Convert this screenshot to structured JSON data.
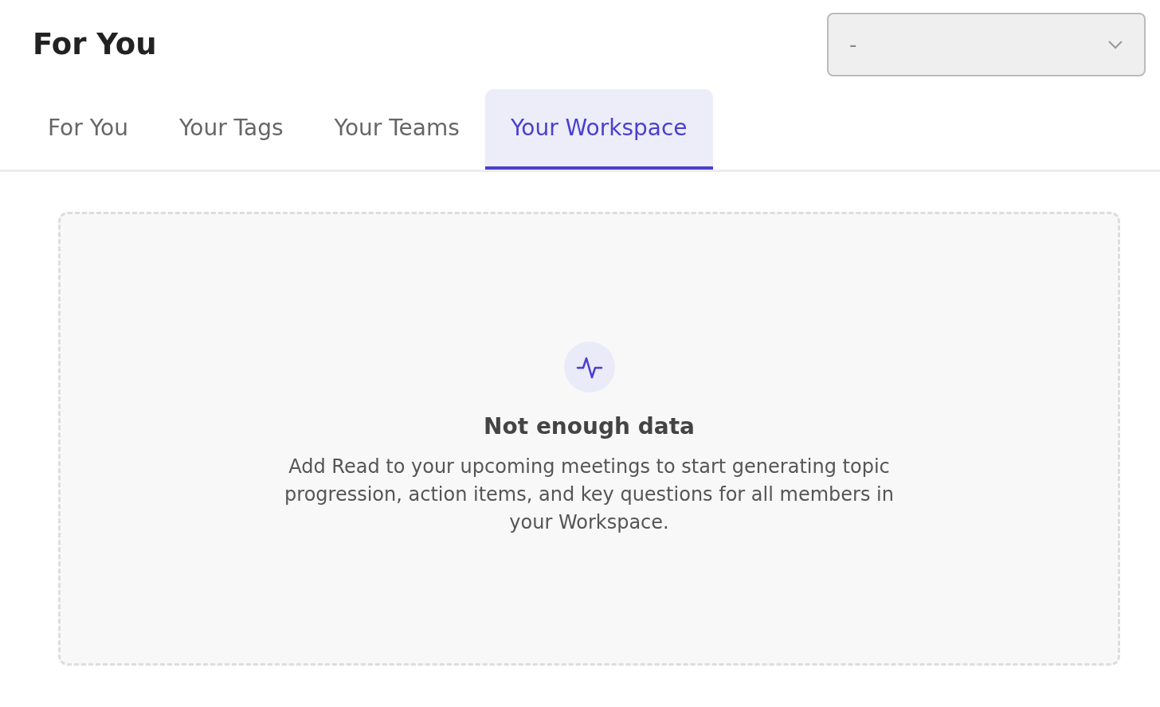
{
  "header": {
    "title": "For You"
  },
  "dropdown": {
    "value": "-"
  },
  "tabs": [
    {
      "label": "For You",
      "selected": false
    },
    {
      "label": "Your Tags",
      "selected": false
    },
    {
      "label": "Your Teams",
      "selected": false
    },
    {
      "label": "Your Workspace",
      "selected": true
    }
  ],
  "empty_state": {
    "title": "Not enough data",
    "message": "Add Read to your upcoming meetings to start generating topic progression, action items, and key questions for all members in your Workspace."
  }
}
